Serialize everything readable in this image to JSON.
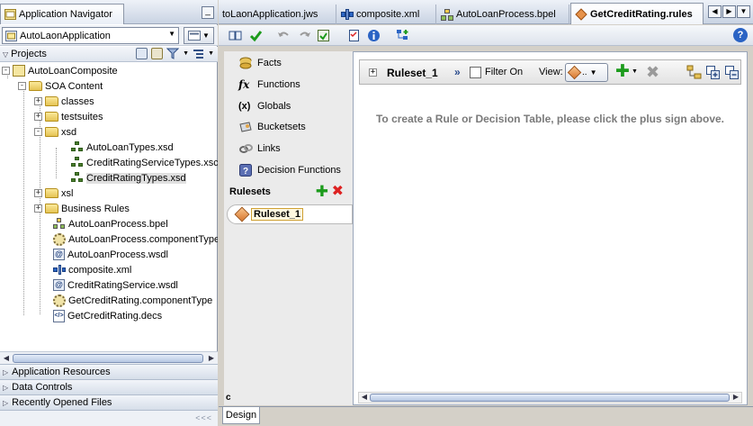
{
  "navigator": {
    "title": "Application Navigator",
    "minimize": "_",
    "application": "AutoLaonApplication",
    "projects_label": "Projects",
    "tree": [
      {
        "label": "AutoLoanComposite",
        "icon": "project-icon",
        "level": 0,
        "expander": "-"
      },
      {
        "label": "SOA Content",
        "icon": "folder-icon",
        "level": 1,
        "expander": "-"
      },
      {
        "label": "classes",
        "icon": "folder-icon",
        "level": 2,
        "expander": "+"
      },
      {
        "label": "testsuites",
        "icon": "folder-icon",
        "level": 2,
        "expander": "+"
      },
      {
        "label": "xsd",
        "icon": "folder-icon",
        "level": 2,
        "expander": "-"
      },
      {
        "label": "AutoLoanTypes.xsd",
        "icon": "xsd-icon",
        "level": 3,
        "expander": ""
      },
      {
        "label": "CreditRatingServiceTypes.xsc",
        "icon": "xsd-icon",
        "level": 3,
        "expander": ""
      },
      {
        "label": "CreditRatingTypes.xsd",
        "icon": "xsd-icon",
        "level": 3,
        "expander": "",
        "selected": true
      },
      {
        "label": "xsl",
        "icon": "folder-icon",
        "level": 2,
        "expander": "+"
      },
      {
        "label": "Business Rules",
        "icon": "folder-icon",
        "level": 2,
        "expander": "+"
      },
      {
        "label": "AutoLoanProcess.bpel",
        "icon": "bpel-icon",
        "level": 2,
        "expander": ""
      },
      {
        "label": "AutoLoanProcess.componentType",
        "icon": "component-type-icon",
        "level": 2,
        "expander": ""
      },
      {
        "label": "AutoLoanProcess.wsdl",
        "icon": "wsdl-icon",
        "level": 2,
        "expander": ""
      },
      {
        "label": "composite.xml",
        "icon": "composite-icon",
        "level": 2,
        "expander": ""
      },
      {
        "label": "CreditRatingService.wsdl",
        "icon": "wsdl-icon",
        "level": 2,
        "expander": ""
      },
      {
        "label": "GetCreditRating.componentType",
        "icon": "component-type-icon",
        "level": 2,
        "expander": ""
      },
      {
        "label": "GetCreditRating.decs",
        "icon": "decs-icon",
        "level": 2,
        "expander": ""
      }
    ],
    "accordions": [
      "Application Resources",
      "Data Controls",
      "Recently Opened Files"
    ],
    "bottom_arrows": "<<<"
  },
  "editor": {
    "tabs": [
      {
        "label": "toLaonApplication.jws",
        "icon": ""
      },
      {
        "label": "composite.xml",
        "icon": "composite-icon"
      },
      {
        "label": "AutoLoanProcess.bpel",
        "icon": "bpel-icon"
      },
      {
        "label": "GetCreditRating.rules",
        "icon": "rules-icon",
        "active": true
      }
    ],
    "help_label": "?",
    "sections": [
      {
        "label": "Facts",
        "icon": "facts-icon"
      },
      {
        "label": "Functions",
        "icon": "functions-icon",
        "glyph": "fx"
      },
      {
        "label": "Globals",
        "icon": "globals-icon",
        "glyph": "(x)"
      },
      {
        "label": "Bucketsets",
        "icon": "bucketsets-icon"
      },
      {
        "label": "Links",
        "icon": "links-icon"
      },
      {
        "label": "Decision Functions",
        "icon": "decision-functions-icon"
      }
    ],
    "rulesets_label": "Rulesets",
    "rulesets": [
      {
        "label": "Ruleset_1",
        "selected": true
      }
    ],
    "ruleset_panel": {
      "name": "Ruleset_1",
      "filter_label": "Filter On",
      "filter_checked": false,
      "view_label": "View:",
      "view_value": "..",
      "hint": "To create a Rule or Decision Table, please click the plus sign above."
    },
    "design_tab": "Design",
    "corner_glyph": "c"
  },
  "colors": {
    "accent_blue": "#2a63c4",
    "add_green": "#1c9b1c",
    "delete_red": "#dd2222",
    "panel_gray": "#ebebeb"
  }
}
